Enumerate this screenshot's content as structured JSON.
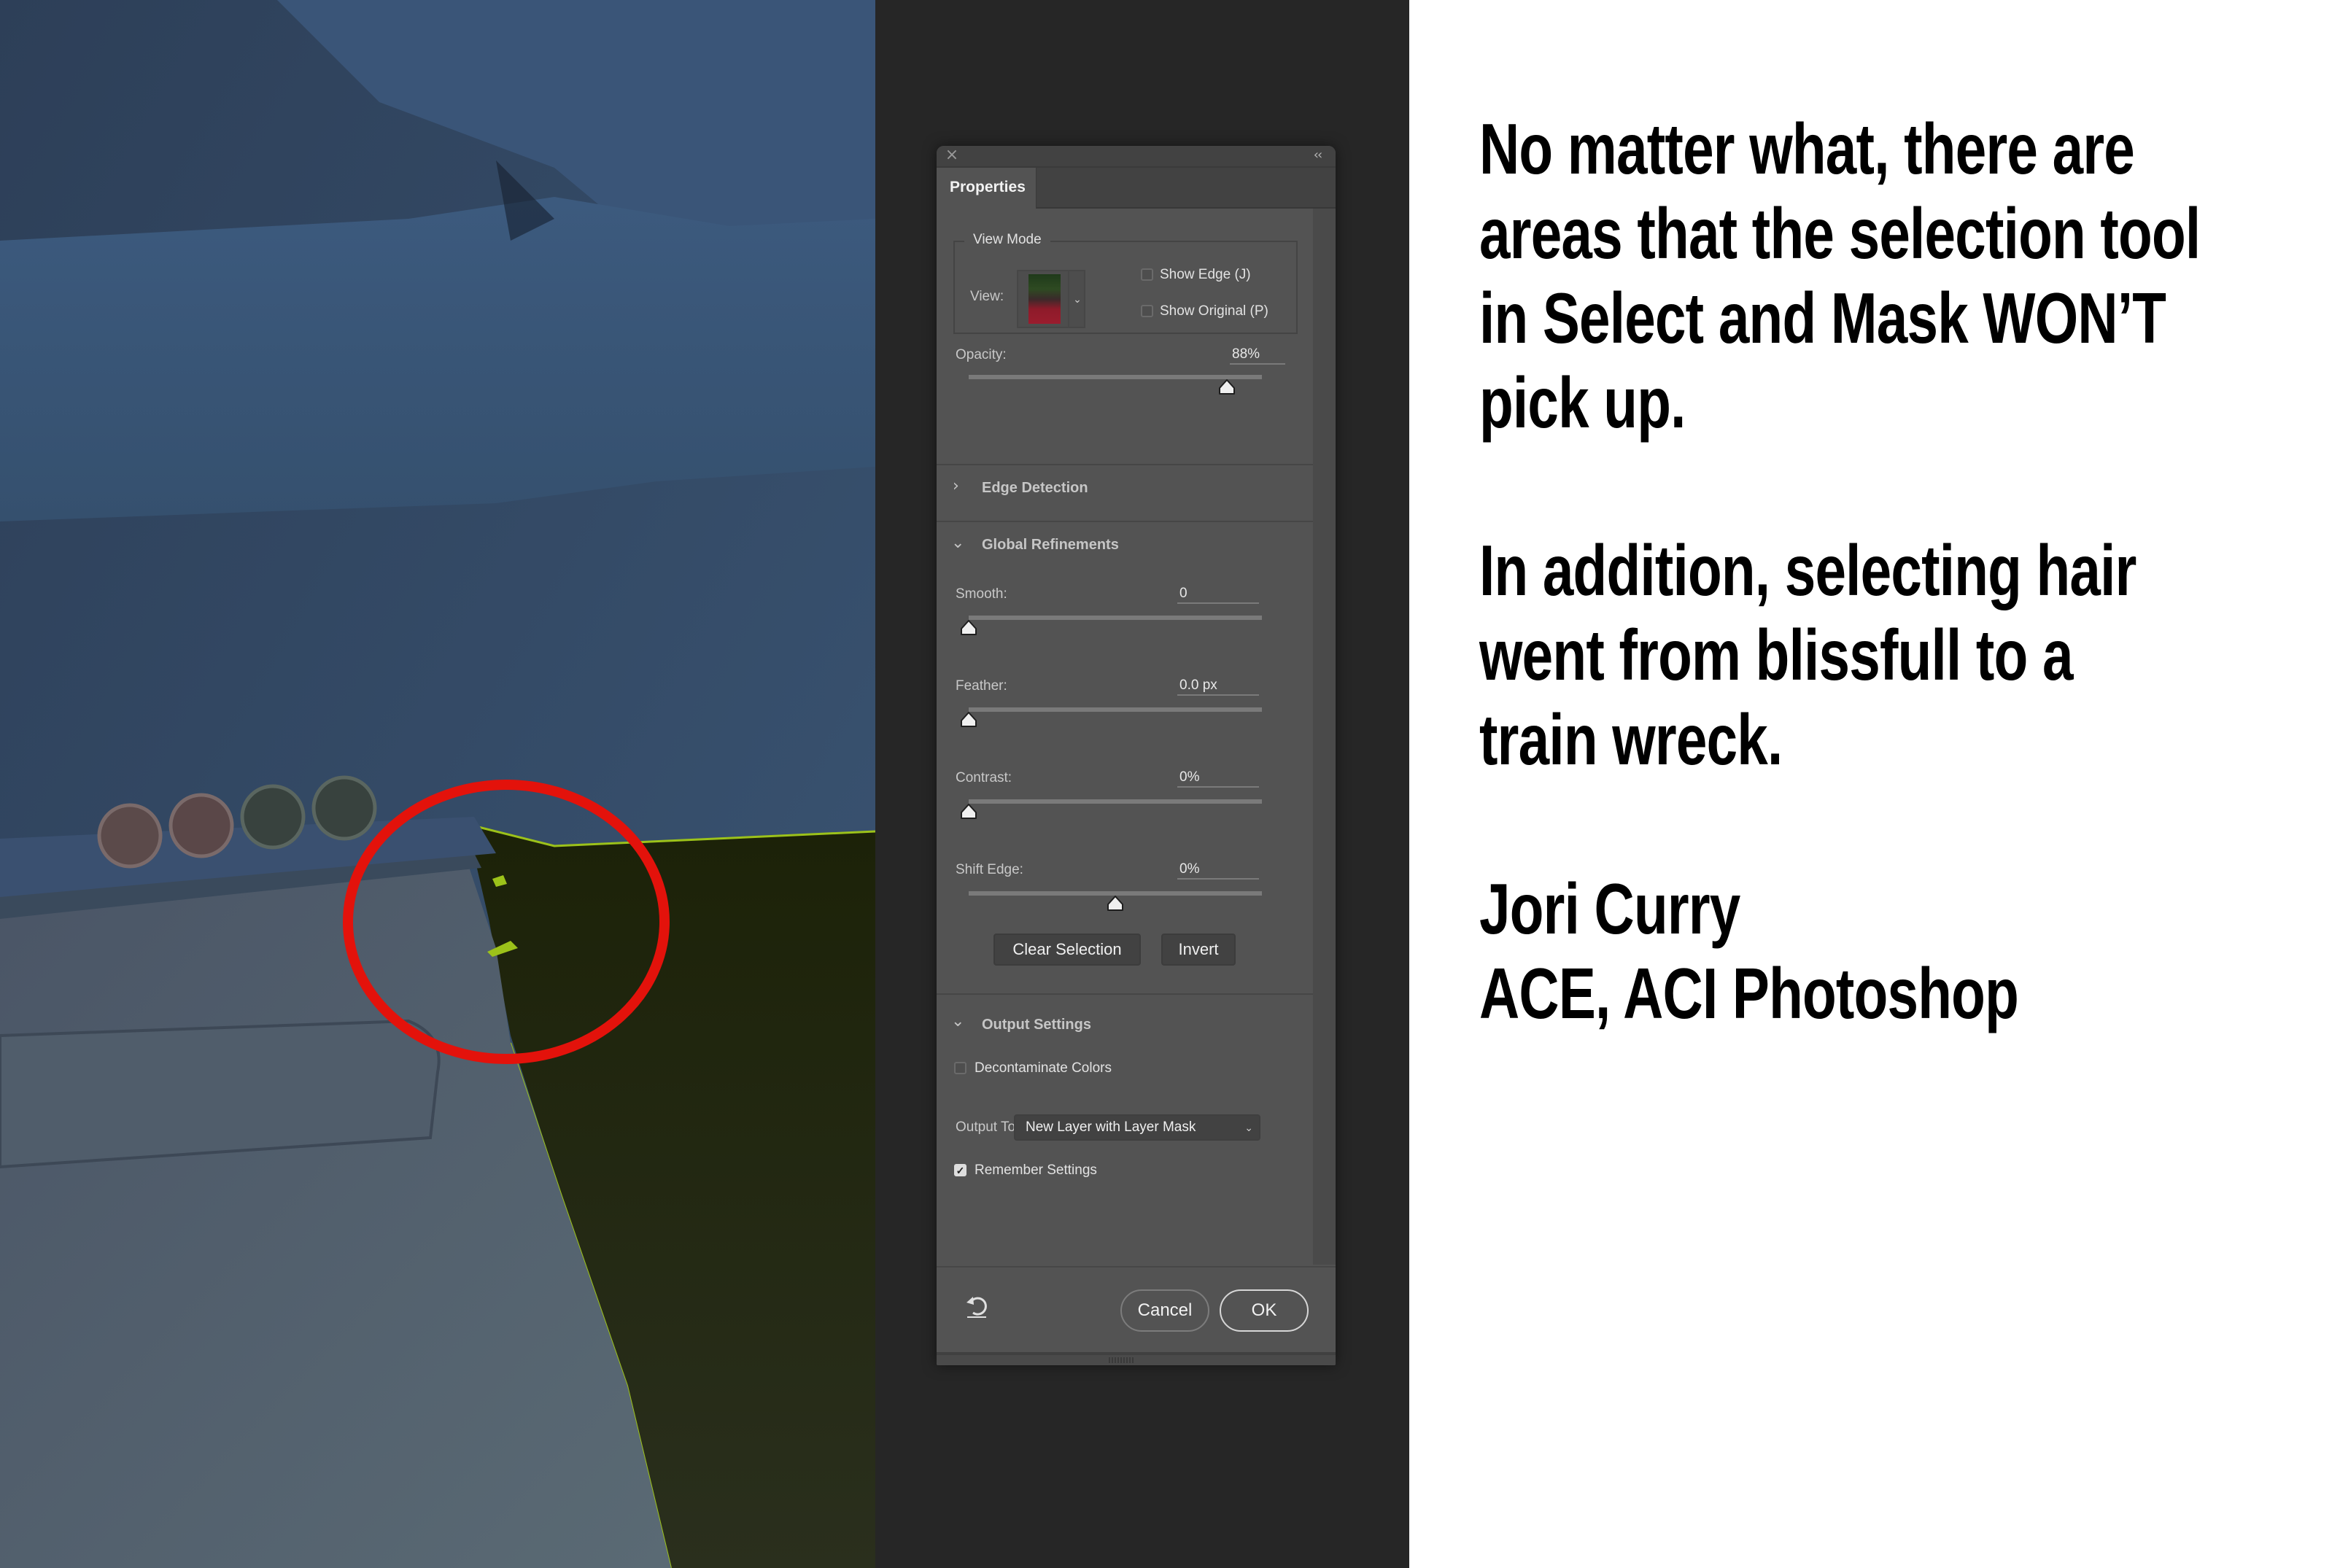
{
  "panel": {
    "close_icon": "×",
    "collapse_icon": "‹‹",
    "tab_label": "Properties",
    "view_mode": {
      "group_title": "View Mode",
      "view_label": "View:",
      "show_edge_label": "Show Edge (J)",
      "show_edge_checked": false,
      "show_original_label": "Show Original (P)",
      "show_original_checked": false
    },
    "opacity": {
      "label": "Opacity:",
      "value_text": "88%",
      "value": 88,
      "min": 0,
      "max": 100
    },
    "sections": {
      "edge_detection": {
        "title": "Edge Detection",
        "expanded": false
      },
      "global_refinements": {
        "title": "Global Refinements",
        "expanded": true
      },
      "output_settings": {
        "title": "Output Settings",
        "expanded": true
      }
    },
    "global_refinements": {
      "smooth": {
        "label": "Smooth:",
        "value_text": "0",
        "value": 0,
        "min": 0,
        "max": 100
      },
      "feather": {
        "label": "Feather:",
        "value_text": "0.0 px",
        "value": 0,
        "min": 0,
        "max": 250
      },
      "contrast": {
        "label": "Contrast:",
        "value_text": "0%",
        "value": 0,
        "min": 0,
        "max": 100
      },
      "shift_edge": {
        "label": "Shift Edge:",
        "value_text": "0%",
        "value": 0,
        "min": -100,
        "max": 100
      },
      "clear_selection_label": "Clear Selection",
      "invert_label": "Invert"
    },
    "output_settings": {
      "decontaminate_label": "Decontaminate Colors",
      "decontaminate_checked": false,
      "output_to_label": "Output To:",
      "output_to_value": "New Layer with Layer Mask"
    },
    "remember_settings_label": "Remember Settings",
    "remember_settings_checked": true,
    "footer": {
      "reset_icon": "reset-icon",
      "cancel_label": "Cancel",
      "ok_label": "OK"
    }
  },
  "slide": {
    "paragraph1": [
      "No matter what, there are",
      "areas that the selection tool",
      "in Select and Mask WON’T",
      "pick up."
    ],
    "paragraph2": [
      "In addition, selecting hair",
      "went from blissfull to a",
      "train wreck."
    ],
    "author": [
      "Jori Curry",
      "ACE, ACI Photoshop"
    ]
  },
  "colors": {
    "highlight_circle": "#e3120b",
    "panel_bg": "#535353",
    "workspace_bg": "#262626",
    "selection_edge": "#9cc21a"
  }
}
